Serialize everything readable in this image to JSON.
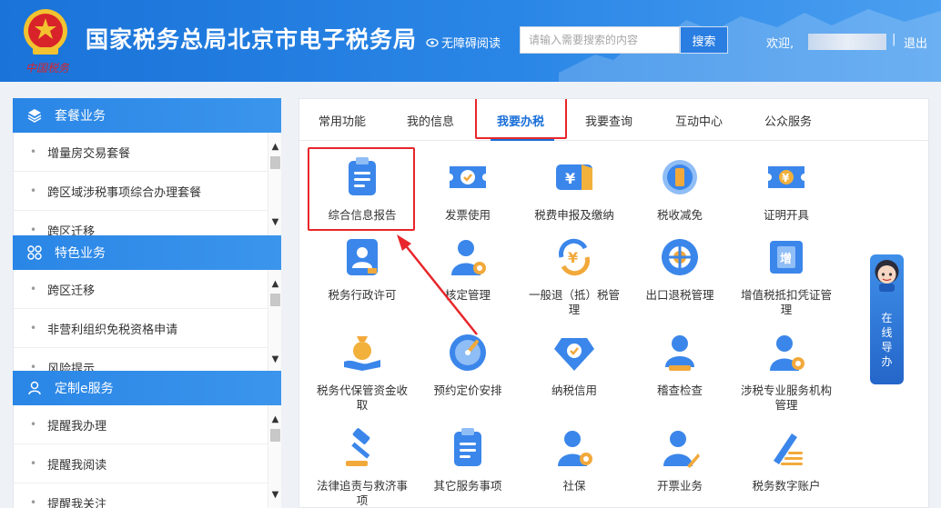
{
  "header": {
    "site_title": "国家税务总局北京市电子税务局",
    "accessibility_label": "无障碍阅读",
    "search_placeholder": "请输入需要搜索的内容",
    "search_button": "搜索",
    "welcome": "欢迎,",
    "separator": "|",
    "logout": "退出",
    "signature_text": "中国税务"
  },
  "sidebar": {
    "sections": [
      {
        "title": "套餐业务",
        "icon": "layers-icon",
        "items": [
          "增量房交易套餐",
          "跨区域涉税事项综合办理套餐",
          "跨区迁移"
        ]
      },
      {
        "title": "特色业务",
        "icon": "grid-icon",
        "items": [
          "跨区迁移",
          "非营利组织免税资格申请",
          "风险提示"
        ]
      },
      {
        "title": "定制e服务",
        "icon": "user-icon",
        "items": [
          "提醒我办理",
          "提醒我阅读",
          "提醒我关注"
        ]
      }
    ]
  },
  "tabs": [
    "常用功能",
    "我的信息",
    "我要办税",
    "我要查询",
    "互动中心",
    "公众服务"
  ],
  "active_tab": "我要办税",
  "functions": [
    "综合信息报告",
    "发票使用",
    "税费申报及缴纳",
    "税收减免",
    "证明开具",
    "税务行政许可",
    "核定管理",
    "一般退（抵）税管理",
    "出口退税管理",
    "增值税抵扣凭证管理",
    "税务代保管资金收取",
    "预约定价安排",
    "纳税信用",
    "稽查检查",
    "涉税专业服务机构管理",
    "法律追责与救济事项",
    "其它服务事项",
    "社保",
    "开票业务",
    "税务数字账户"
  ],
  "guide": {
    "label": [
      "在",
      "线",
      "导",
      "办"
    ]
  },
  "colors": {
    "brand_blue": "#2a86e6",
    "highlight_red": "#e8262c",
    "active_tab": "#1a6fd8"
  }
}
